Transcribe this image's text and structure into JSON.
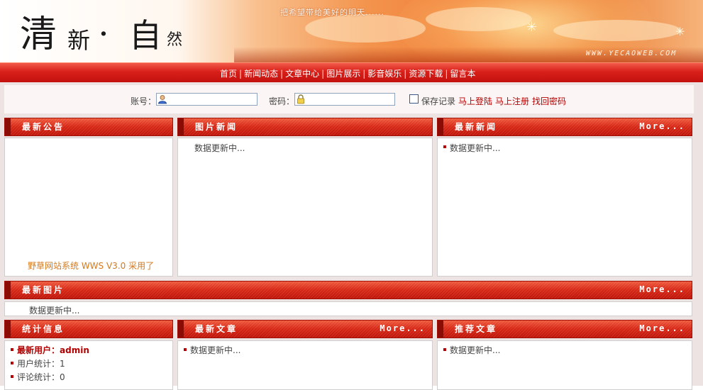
{
  "header": {
    "logo_chars": [
      "清",
      "新",
      "·",
      "自",
      "然"
    ],
    "slogan": "把希望带给美好的明天......",
    "watermark": "WWW.YECAOWEB.COM"
  },
  "nav": {
    "items": [
      "首页",
      "新闻动态",
      "文章中心",
      "图片展示",
      "影音娱乐",
      "资源下载",
      "留言本"
    ],
    "separator": "|"
  },
  "login": {
    "account_label": "账号：",
    "account_value": "",
    "password_label": "密码：",
    "password_value": "",
    "remember_label": "保存记录",
    "login_link": "马上登陆",
    "register_link": "马上注册",
    "recover_link": "找回密码"
  },
  "panels": {
    "notice": {
      "title": "最新公告",
      "text": "野草网站系统 WWS V3.0 采用了"
    },
    "photo_news": {
      "title": "图片新闻",
      "content": "数据更新中..."
    },
    "latest_news": {
      "title": "最新新闻",
      "more": "More...",
      "content": "数据更新中..."
    },
    "latest_photos": {
      "title": "最新图片",
      "more": "More...",
      "content": "数据更新中..."
    },
    "stats": {
      "title": "统计信息",
      "new_user_label": "最新用户：",
      "new_user_value": "admin",
      "users_label": "用户统计：",
      "users_value": "1",
      "comments_label": "评论统计：",
      "comments_value": "0"
    },
    "latest_articles": {
      "title": "最新文章",
      "more": "More...",
      "content": "数据更新中..."
    },
    "recommended": {
      "title": "推荐文章",
      "more": "More...",
      "content": "数据更新中..."
    }
  },
  "colors": {
    "accent_red": "#c4110e",
    "link_red": "#b40000",
    "notice_orange": "#d3791d"
  }
}
